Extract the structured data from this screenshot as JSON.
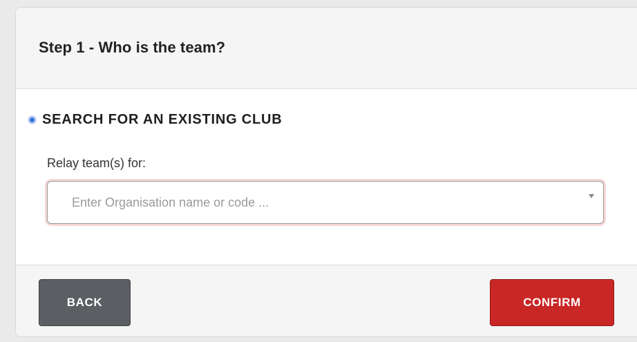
{
  "header": {
    "title": "Step 1 - Who is the team?"
  },
  "search_option": {
    "label": "SEARCH FOR AN EXISTING CLUB",
    "selected": true
  },
  "organisation_field": {
    "label": "Relay team(s) for:",
    "placeholder": "Enter Organisation name or code ..."
  },
  "footer": {
    "back_label": "BACK",
    "confirm_label": "CONFIRM"
  },
  "colors": {
    "confirm": "#c92626",
    "back": "#5b5e62",
    "radio": "#2f6fe0"
  }
}
